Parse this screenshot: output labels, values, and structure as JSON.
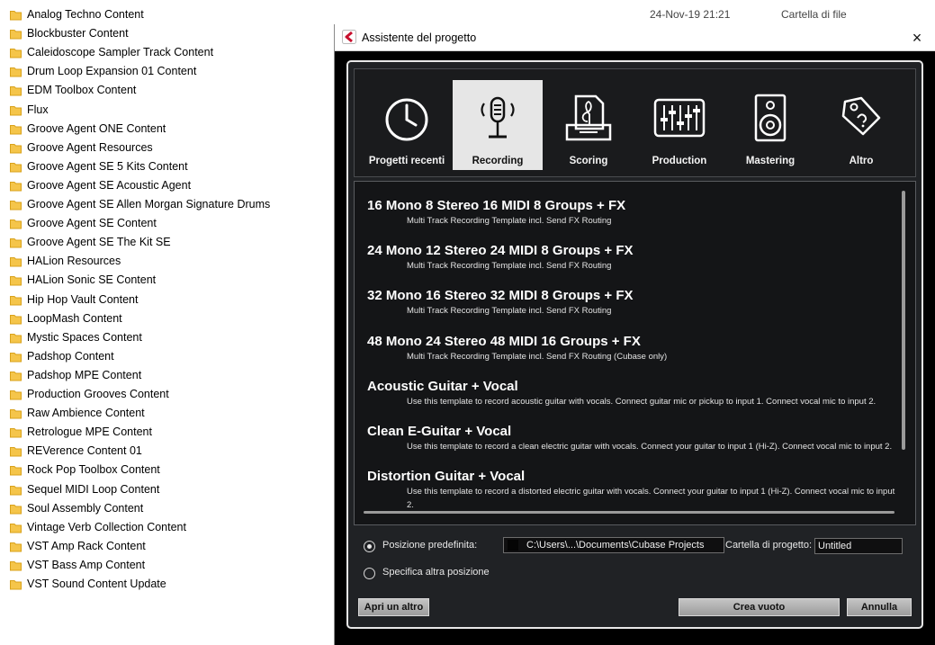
{
  "explorer": {
    "header": {
      "date": "24-Nov-19 21:21",
      "type": "Cartella di file"
    },
    "files": [
      "Analog Techno Content",
      "Blockbuster Content",
      "Caleidoscope Sampler Track Content",
      "Drum Loop Expansion 01 Content",
      "EDM Toolbox Content",
      "Flux",
      "Groove Agent ONE Content",
      "Groove Agent Resources",
      "Groove Agent SE 5 Kits Content",
      "Groove Agent SE Acoustic Agent",
      "Groove Agent SE Allen Morgan Signature Drums",
      "Groove Agent SE Content",
      "Groove Agent SE The Kit SE",
      "HALion Resources",
      "HALion Sonic SE Content",
      "Hip Hop Vault Content",
      "LoopMash Content",
      "Mystic Spaces Content",
      "Padshop Content",
      "Padshop MPE Content",
      "Production Grooves Content",
      "Raw Ambience Content",
      "Retrologue MPE Content",
      "REVerence Content 01",
      "Rock Pop Toolbox Content",
      "Sequel MIDI Loop Content",
      "Soul Assembly Content",
      "Vintage Verb Collection Content",
      "VST Amp Rack Content",
      "VST Bass Amp Content",
      "VST Sound Content Update"
    ]
  },
  "dialog": {
    "title": "Assistente del progetto",
    "close_icon": "×",
    "categories": [
      {
        "label": "Progetti recenti",
        "icon": "clock-icon",
        "selected": false
      },
      {
        "label": "Recording",
        "icon": "microphone-icon",
        "selected": true
      },
      {
        "label": "Scoring",
        "icon": "sheet-music-icon",
        "selected": false
      },
      {
        "label": "Production",
        "icon": "mixer-faders-icon",
        "selected": false
      },
      {
        "label": "Mastering",
        "icon": "speaker-icon",
        "selected": false
      },
      {
        "label": "Altro",
        "icon": "tag-icon",
        "selected": false
      }
    ],
    "templates": [
      {
        "title": "16 Mono 8 Stereo 16 MIDI 8 Groups + FX",
        "desc": "Multi Track Recording Template incl. Send FX Routing"
      },
      {
        "title": "24 Mono 12 Stereo 24 MIDI 8 Groups + FX",
        "desc": "Multi Track Recording Template incl. Send FX Routing"
      },
      {
        "title": "32 Mono 16 Stereo 32 MIDI 8 Groups + FX",
        "desc": "Multi Track Recording Template incl. Send FX Routing"
      },
      {
        "title": "48 Mono 24 Stereo 48 MIDI 16 Groups + FX",
        "desc": "Multi Track Recording Template incl. Send FX Routing (Cubase only)"
      },
      {
        "title": "Acoustic Guitar + Vocal",
        "desc": "Use this template to record acoustic guitar with vocals. Connect guitar mic or pickup to input  1. Connect vocal mic to input 2."
      },
      {
        "title": "Clean E-Guitar + Vocal",
        "desc": "Use this template to record a clean electric guitar with vocals. Connect your guitar to input  1 (Hi-Z). Connect vocal mic to input 2."
      },
      {
        "title": "Distortion Guitar + Vocal",
        "desc": "Use this template to record a distorted electric guitar with vocals. Connect your guitar to input  1 (Hi-Z). Connect vocal mic to input 2."
      }
    ],
    "location": {
      "default_label": "Posizione predefinita:",
      "default_path": "C:\\Users\\...\\Documents\\Cubase Projects",
      "other_label": "Specifica altra posizione",
      "folder_label": "Cartella di progetto:",
      "folder_value": "Untitled",
      "selected": "default"
    },
    "buttons": {
      "open_other": "Apri un altro",
      "create_empty": "Crea vuoto",
      "cancel": "Annulla"
    }
  }
}
